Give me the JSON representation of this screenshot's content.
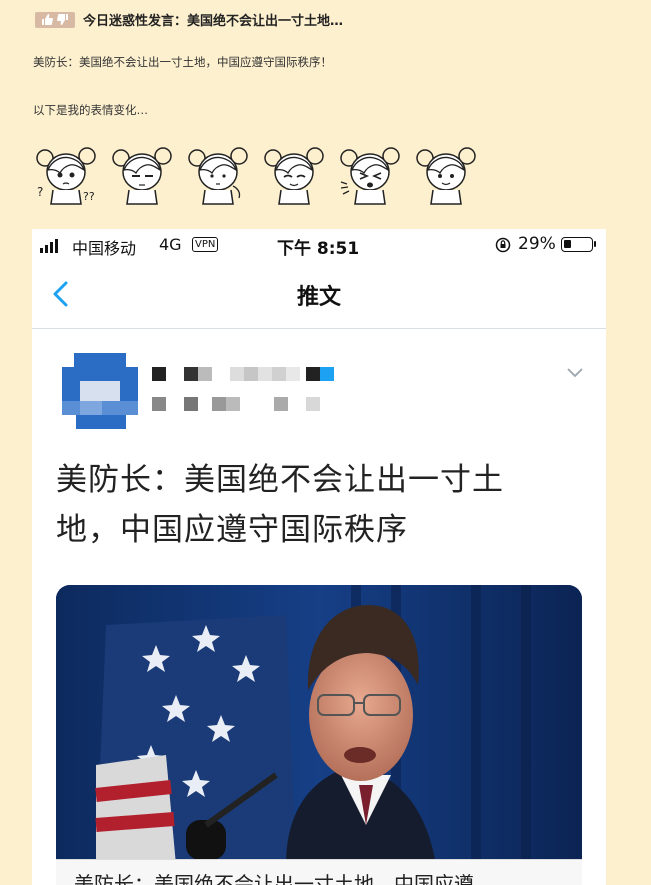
{
  "post": {
    "title": "今日迷惑性发言：美国绝不会让出一寸土地…",
    "line1": "美防长：美国绝不会让出一寸土地，中国应遵守国际秩序！",
    "line2": "以下是我的表情变化…"
  },
  "reaction_faces": [
    "confused-face",
    "staring-face",
    "blank-face",
    "smug-face",
    "spitting-face",
    "smiling-face"
  ],
  "phone": {
    "status": {
      "carrier": "中国移动",
      "network": "4G",
      "vpn": "VPN",
      "time": "下午 8:51",
      "battery_text": "29%",
      "battery_level": 0.29
    },
    "nav": {
      "title": "推文"
    },
    "tweet": {
      "text_line1": "美防长：美国绝不会让出一寸土",
      "text_line2": "地，中国应遵守国际秩序",
      "media_caption": "美防长：美国绝不会让出一寸土地，中国应遵"
    }
  },
  "colors": {
    "page_background": "#fdf0cf",
    "link_blue": "#1da1f2",
    "avatar_blue": "#2b6cc4"
  }
}
